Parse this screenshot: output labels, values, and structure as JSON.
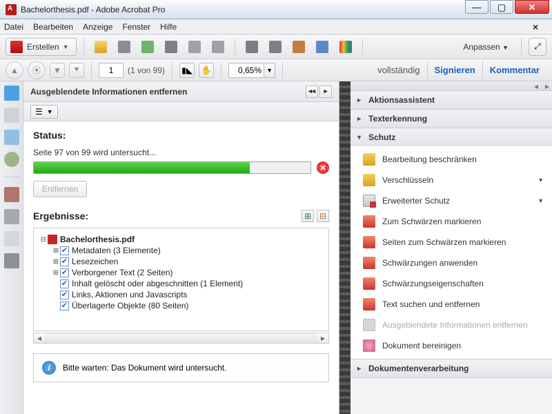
{
  "window": {
    "title": "Bachelorthesis.pdf - Adobe Acrobat Pro"
  },
  "menu": {
    "file": "Datei",
    "edit": "Bearbeiten",
    "view": "Anzeige",
    "window": "Fenster",
    "help": "Hilfe"
  },
  "toolbar": {
    "create": "Erstellen",
    "customize": "Anpassen"
  },
  "nav": {
    "page_value": "1",
    "page_count": "(1 von 99)",
    "zoom": "0,65%"
  },
  "tabs": {
    "full": "vollständig",
    "sign": "Signieren",
    "comment": "Kommentar"
  },
  "panel": {
    "title": "Ausgeblendete Informationen entfernen",
    "status_label": "Status:",
    "status_text": "Seite 97 von 99 wird untersucht...",
    "remove_btn": "Entfernen",
    "results_label": "Ergebnisse:",
    "root": "Bachelorthesis.pdf",
    "items": [
      "Metadaten (3 Elemente)",
      "Lesezeichen",
      "Verborgener Text (2 Seiten)",
      "Inhalt gelöscht oder abgeschnitten (1 Element)",
      "Links, Aktionen und Javascripts",
      "Überlagerte Objekte (80 Seiten)"
    ],
    "wait": "Bitte warten: Das Dokument wird untersucht."
  },
  "sidebar": {
    "sections": {
      "action": "Aktionsassistent",
      "ocr": "Texterkennung",
      "protect": "Schutz",
      "docproc": "Dokumentenverarbeitung"
    },
    "protect_items": [
      {
        "label": "Bearbeitung beschränken",
        "icon": "shield",
        "drop": false
      },
      {
        "label": "Verschlüsseln",
        "icon": "shield",
        "drop": true
      },
      {
        "label": "Erweiterter Schutz",
        "icon": "doc",
        "drop": true
      },
      {
        "label": "Zum Schwärzen markieren",
        "icon": "red",
        "drop": false
      },
      {
        "label": "Seiten zum Schwärzen markieren",
        "icon": "red",
        "drop": false
      },
      {
        "label": "Schwärzungen anwenden",
        "icon": "red",
        "drop": false
      },
      {
        "label": "Schwärzungseigenschaften",
        "icon": "red",
        "drop": false
      },
      {
        "label": "Text suchen und entfernen",
        "icon": "red",
        "drop": false
      },
      {
        "label": "Ausgeblendete Informationen entfernen",
        "icon": "grey",
        "drop": false,
        "disabled": true
      },
      {
        "label": "Dokument bereinigen",
        "icon": "clean",
        "drop": false
      }
    ]
  }
}
